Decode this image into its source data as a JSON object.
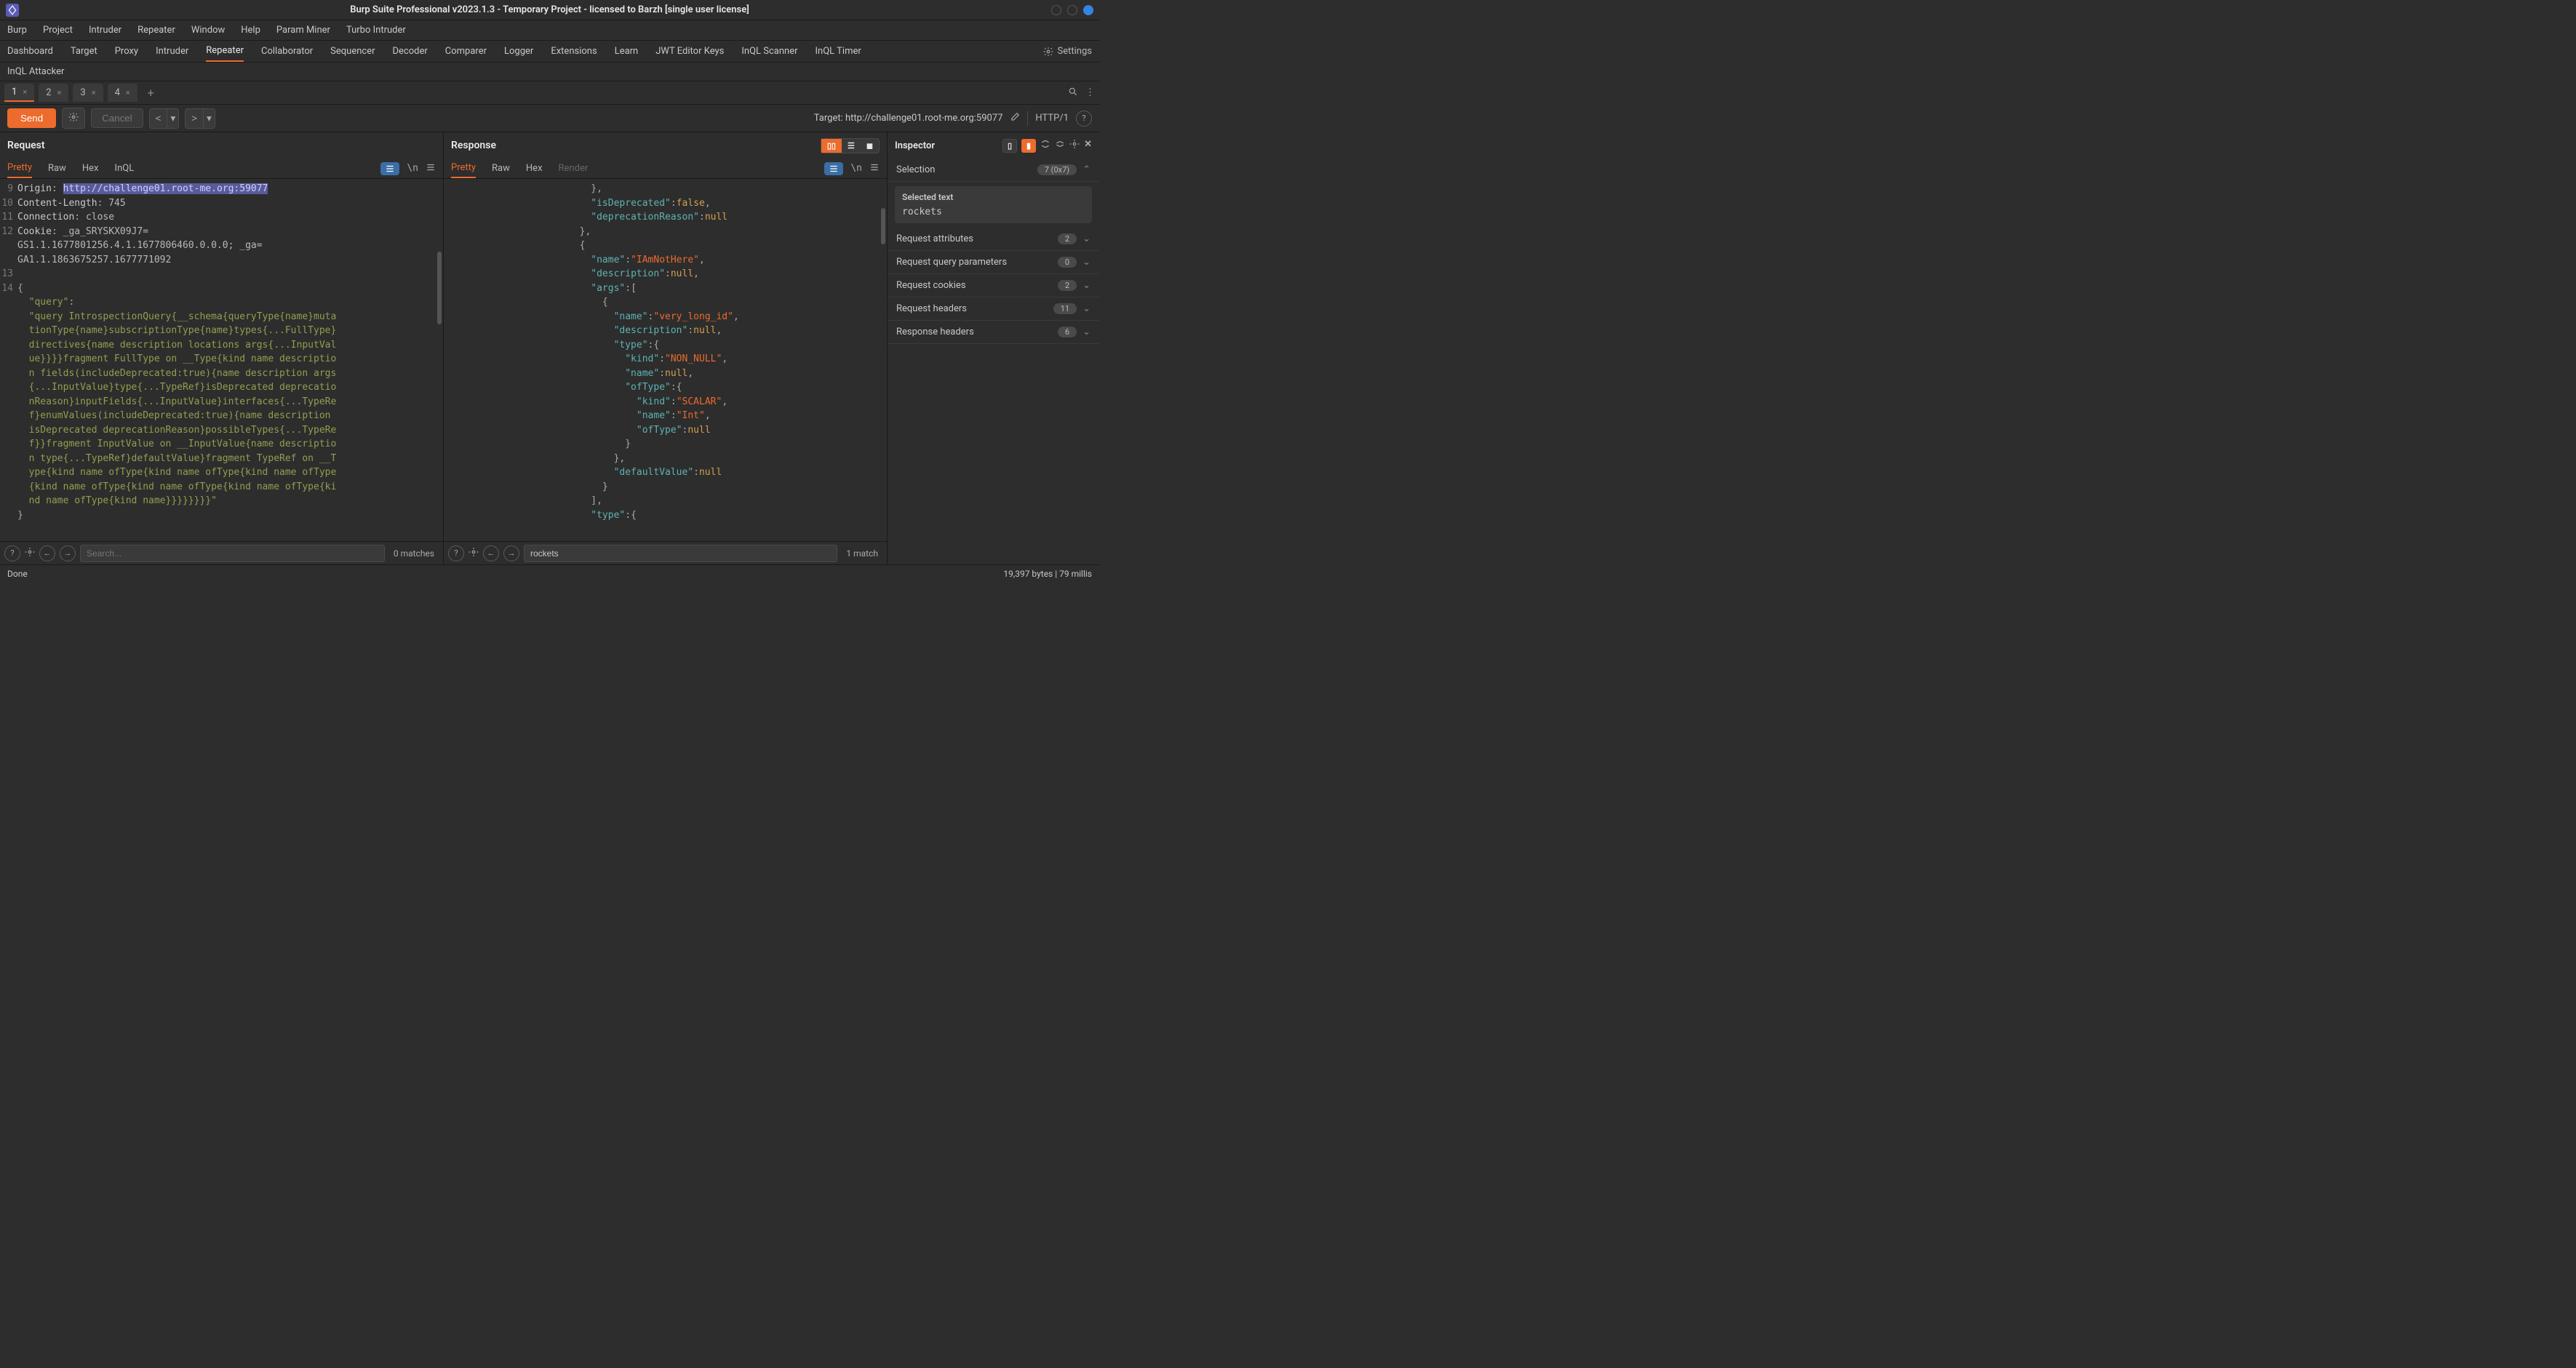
{
  "titlebar": {
    "title": "Burp Suite Professional v2023.1.3 - Temporary Project - licensed to Barzh [single user license]"
  },
  "menubar": [
    "Burp",
    "Project",
    "Intruder",
    "Repeater",
    "Window",
    "Help",
    "Param Miner",
    "Turbo Intruder"
  ],
  "maintabs": {
    "items": [
      "Dashboard",
      "Target",
      "Proxy",
      "Intruder",
      "Repeater",
      "Collaborator",
      "Sequencer",
      "Decoder",
      "Comparer",
      "Logger",
      "Extensions",
      "Learn",
      "JWT Editor Keys",
      "InQL Scanner",
      "InQL Timer"
    ],
    "active": "Repeater",
    "settings_label": "Settings"
  },
  "maintabs2": {
    "items": [
      "InQL Attacker"
    ]
  },
  "subtabs": {
    "items": [
      "1",
      "2",
      "3",
      "4"
    ],
    "active": "1"
  },
  "toolbar": {
    "send": "Send",
    "cancel": "Cancel",
    "target_label": "Target: http://challenge01.root-me.org:59077",
    "protocol": "HTTP/1"
  },
  "request": {
    "title": "Request",
    "tabs": [
      "Pretty",
      "Raw",
      "Hex",
      "InQL"
    ],
    "active": "Pretty",
    "lines": [
      {
        "n": "9",
        "html": "<span class='c-prop'>Origin</span><span class='c-punc'>: </span><span class='hl-link'>http://challenge01.root-me.org:59077</span>"
      },
      {
        "n": "10",
        "html": "<span class='c-prop'>Content-Length</span><span class='c-punc'>: </span><span class='c-kw'>745</span>"
      },
      {
        "n": "11",
        "html": "<span class='c-prop'>Connection</span><span class='c-punc'>: </span><span class='c-kw'>close</span>"
      },
      {
        "n": "12",
        "html": "<span class='c-prop'>Cookie</span><span class='c-punc'>: </span><span class='c-kw'>_ga_SRYSKX09J7=</span>"
      },
      {
        "n": "",
        "html": "<span class='c-kw'>GS1.1.1677801256.4.1.1677806460.0.0.0; _ga=</span>"
      },
      {
        "n": "",
        "html": "<span class='c-kw'>GA1.1.1863675257.1677771092</span>"
      },
      {
        "n": "13",
        "html": ""
      },
      {
        "n": "14",
        "html": "<span class='c-punc'>{</span>"
      },
      {
        "n": "",
        "html": "  <span class='c-green'>\"query\"</span><span class='c-punc'>:</span>"
      },
      {
        "n": "",
        "html": "  <span class='c-green'>\"query IntrospectionQuery{__schema{queryType{name}muta</span>"
      },
      {
        "n": "",
        "html": "  <span class='c-green'>tionType{name}subscriptionType{name}types{...FullType}</span>"
      },
      {
        "n": "",
        "html": "  <span class='c-green'>directives{name description locations args{...InputVal</span>"
      },
      {
        "n": "",
        "html": "  <span class='c-green'>ue}}}}fragment FullType on __Type{kind name descriptio</span>"
      },
      {
        "n": "",
        "html": "  <span class='c-green'>n fields(includeDeprecated:true){name description args</span>"
      },
      {
        "n": "",
        "html": "  <span class='c-green'>{...InputValue}type{...TypeRef}isDeprecated deprecatio</span>"
      },
      {
        "n": "",
        "html": "  <span class='c-green'>nReason}inputFields{...InputValue}interfaces{...TypeRe</span>"
      },
      {
        "n": "",
        "html": "  <span class='c-green'>f}enumValues(includeDeprecated:true){name description </span>"
      },
      {
        "n": "",
        "html": "  <span class='c-green'>isDeprecated deprecationReason}possibleTypes{...TypeRe</span>"
      },
      {
        "n": "",
        "html": "  <span class='c-green'>f}}fragment InputValue on __InputValue{name descriptio</span>"
      },
      {
        "n": "",
        "html": "  <span class='c-green'>n type{...TypeRef}defaultValue}fragment TypeRef on __T</span>"
      },
      {
        "n": "",
        "html": "  <span class='c-green'>ype{kind name ofType{kind name ofType{kind name ofType</span>"
      },
      {
        "n": "",
        "html": "  <span class='c-green'>{kind name ofType{kind name ofType{kind name ofType{ki</span>"
      },
      {
        "n": "",
        "html": "  <span class='c-green'>nd name ofType{kind name}}}}}}}}\"</span>"
      },
      {
        "n": "",
        "html": "<span class='c-punc'>}</span>"
      }
    ],
    "search_placeholder": "Search...",
    "search_matches": "0 matches"
  },
  "response": {
    "title": "Response",
    "tabs": [
      "Pretty",
      "Raw",
      "Hex",
      "Render"
    ],
    "active": "Pretty",
    "lines": [
      "          <span class='c-punc'>},</span>",
      "          <span class='c-key'>\"isDeprecated\"</span><span class='c-punc'>:</span><span class='c-val'>false</span><span class='c-punc'>,</span>",
      "          <span class='c-key'>\"deprecationReason\"</span><span class='c-punc'>:</span><span class='c-val'>null</span>",
      "        <span class='c-punc'>},</span>",
      "        <span class='c-punc'>{</span>",
      "          <span class='c-key'>\"name\"</span><span class='c-punc'>:</span><span class='c-str'>\"IAmNotHere\"</span><span class='c-punc'>,</span>",
      "          <span class='c-key'>\"description\"</span><span class='c-punc'>:</span><span class='c-val'>null</span><span class='c-punc'>,</span>",
      "          <span class='c-key'>\"args\"</span><span class='c-punc'>:[</span>",
      "            <span class='c-punc'>{</span>",
      "              <span class='c-key'>\"name\"</span><span class='c-punc'>:</span><span class='c-str'>\"very_long_id\"</span><span class='c-punc'>,</span>",
      "              <span class='c-key'>\"description\"</span><span class='c-punc'>:</span><span class='c-val'>null</span><span class='c-punc'>,</span>",
      "              <span class='c-key'>\"type\"</span><span class='c-punc'>:{</span>",
      "                <span class='c-key'>\"kind\"</span><span class='c-punc'>:</span><span class='c-str'>\"NON_NULL\"</span><span class='c-punc'>,</span>",
      "                <span class='c-key'>\"name\"</span><span class='c-punc'>:</span><span class='c-val'>null</span><span class='c-punc'>,</span>",
      "                <span class='c-key'>\"ofType\"</span><span class='c-punc'>:{</span>",
      "                  <span class='c-key'>\"kind\"</span><span class='c-punc'>:</span><span class='c-str'>\"SCALAR\"</span><span class='c-punc'>,</span>",
      "                  <span class='c-key'>\"name\"</span><span class='c-punc'>:</span><span class='c-str'>\"Int\"</span><span class='c-punc'>,</span>",
      "                  <span class='c-key'>\"ofType\"</span><span class='c-punc'>:</span><span class='c-val'>null</span>",
      "                <span class='c-punc'>}</span>",
      "              <span class='c-punc'>},</span>",
      "              <span class='c-key'>\"defaultValue\"</span><span class='c-punc'>:</span><span class='c-val'>null</span>",
      "            <span class='c-punc'>}</span>",
      "          <span class='c-punc'>],</span>",
      "          <span class='c-key'>\"type\"</span><span class='c-punc'>:{</span>"
    ],
    "search_value": "rockets",
    "search_matches": "1 match"
  },
  "inspector": {
    "title": "Inspector",
    "selection": {
      "label": "Selection",
      "badge": "7 (0x7)"
    },
    "selected_text": {
      "label": "Selected text",
      "value": "rockets"
    },
    "sections": [
      {
        "label": "Request attributes",
        "count": "2"
      },
      {
        "label": "Request query parameters",
        "count": "0"
      },
      {
        "label": "Request cookies",
        "count": "2"
      },
      {
        "label": "Request headers",
        "count": "11"
      },
      {
        "label": "Response headers",
        "count": "6"
      }
    ]
  },
  "statusbar": {
    "left": "Done",
    "right": "19,397 bytes | 79 millis"
  }
}
